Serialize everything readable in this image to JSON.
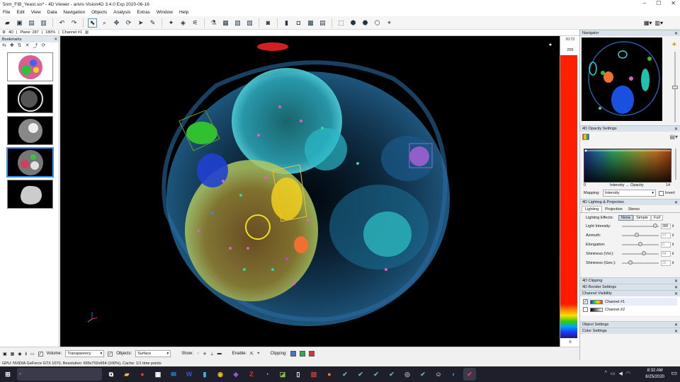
{
  "window": {
    "title": "5nm_FIB_Yeast.sis* - 4D Viewer - arivis Vision4D 3.4.0 Exp 2020-06-16",
    "minimize": "–",
    "maximize": "☐",
    "close": "✕"
  },
  "menu": [
    "File",
    "Edit",
    "View",
    "Data",
    "Navigation",
    "Objects",
    "Analysis",
    "Extras",
    "Window",
    "Help"
  ],
  "status_line": {
    "mode": "4D",
    "plane": "Plane: 287",
    "zoom": "180%",
    "channel": "Channel #1"
  },
  "bookmarks": {
    "title": "Bookmarks",
    "close": "✕"
  },
  "lut": {
    "max_label": "8173",
    "max_value": "255",
    "min_value": "0"
  },
  "navigator": {
    "title": "Navigator",
    "close": "✕"
  },
  "opacity_settings": {
    "title": "4D Opacity Settings",
    "min": "0",
    "max": "14",
    "axis_label": "Intensity → Opacity",
    "mapping_label": "Mapping:",
    "mapping_value": "Intensity",
    "invert_label": "Invert"
  },
  "lighting": {
    "title": "4D Lighting & Projection",
    "tabs": [
      "Lighting",
      "Projection",
      "Stereo"
    ],
    "effects_label": "Lighting Effects:",
    "effects_options": [
      "None",
      "Simple",
      "Full"
    ],
    "params": [
      {
        "label": "Light Intensity:",
        "value": "300",
        "level": 0.95
      },
      {
        "label": "Azimuth:",
        "value": "37",
        "level": 0.4
      },
      {
        "label": "Elongation:",
        "value": "0",
        "level": 0.5
      },
      {
        "label": "Shininess (Vol.):",
        "value": "64",
        "level": 0.6
      },
      {
        "label": "Shininess (Geo.):",
        "value": "25",
        "level": 0.2
      }
    ]
  },
  "panels_collapsed": [
    "4D Clipping",
    "4D Render Settings"
  ],
  "channel_visibility": {
    "title": "Channel Visibility",
    "channels": [
      {
        "label": "Channel #1",
        "checked": true
      },
      {
        "label": "Channel #2",
        "checked": false
      }
    ]
  },
  "panels_bottom": [
    "Object Settings",
    "Color Settings"
  ],
  "bottom_bar": {
    "volume_label": "Volume:",
    "volume_value": "Transparency",
    "objects_label": "Objects:",
    "objects_value": "Surface",
    "show_label": "Show:",
    "enable_label": "Enable:",
    "clipping_label": "Clipping:"
  },
  "gpu_info": "GPU: NVIDIA GeForce GTX 1070, Resolution: 665x702x654 (100%), Cache: 1/1 time points",
  "clock": {
    "time": "8:32 AM",
    "date": "6/25/2020"
  },
  "colors": {
    "accent": "#3399ff",
    "volume_cyan": "#30b8d8",
    "volume_yellow": "#c8b030"
  }
}
